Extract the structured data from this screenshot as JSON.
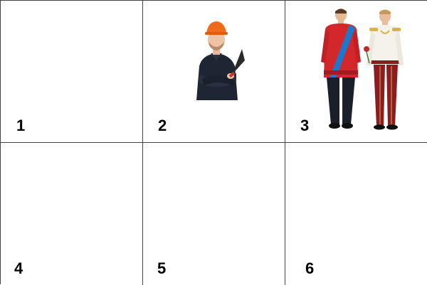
{
  "cells": [
    {
      "label": "1",
      "image": "empty"
    },
    {
      "label": "2",
      "image": "construction-worker-with-trowel"
    },
    {
      "label": "3",
      "image": "two-royal-uniform-men"
    },
    {
      "label": "4",
      "image": "empty"
    },
    {
      "label": "5",
      "image": "empty"
    },
    {
      "label": "6",
      "image": "empty"
    }
  ],
  "colors": {
    "grid_line": "#444444",
    "hard_hat": "#f06a1c",
    "work_uniform": "#1f2633",
    "red_tunic": "#d2282b",
    "sash_blue": "#1e77c8",
    "white_tunic": "#f4f2ea",
    "gold_trim": "#d8b24a",
    "dark_trousers": "#1a1f2b",
    "maroon_trousers": "#8a1c22"
  }
}
